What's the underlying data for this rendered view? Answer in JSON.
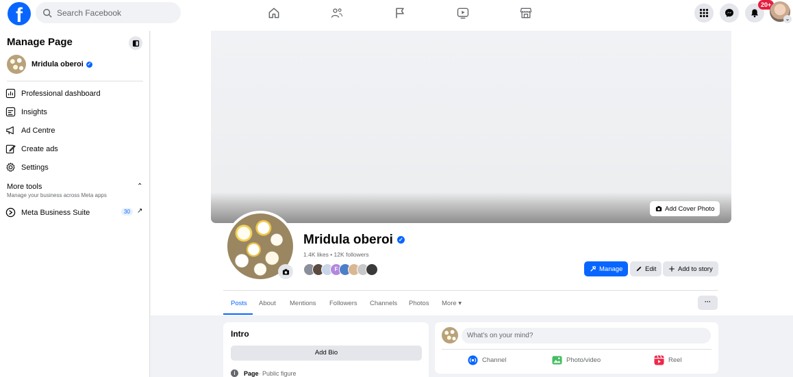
{
  "topbar": {
    "logo_letter": "f",
    "search_placeholder": "Search Facebook",
    "nav_icons": [
      "home-icon",
      "friends-icon",
      "flag-icon",
      "video-icon",
      "marketplace-icon"
    ],
    "right_icons": [
      "menu-grid-icon",
      "messenger-icon",
      "bell-icon"
    ],
    "notification_count": "20+"
  },
  "sidebar": {
    "title": "Manage Page",
    "page_name": "Mridula oberoi",
    "items": [
      {
        "label": "Professional dashboard",
        "icon": "dashboard-icon"
      },
      {
        "label": "Insights",
        "icon": "insights-icon"
      },
      {
        "label": "Ad Centre",
        "icon": "megaphone-icon"
      },
      {
        "label": "Create ads",
        "icon": "pencil-icon"
      },
      {
        "label": "Settings",
        "icon": "gear-icon"
      }
    ],
    "more_tools": {
      "title": "More tools",
      "subtitle": "Manage your business across Meta apps",
      "item_label": "Meta Business Suite",
      "item_badge": "30"
    }
  },
  "cover": {
    "add_cover_label": "Add Cover Photo"
  },
  "profile": {
    "name": "Mridula oberoi",
    "stats": "1.4K likes • 12K followers",
    "follower_avatar_colors": [
      "#8a8f99",
      "#5a4a40",
      "#c9d6e8",
      "#b388dd",
      "#4d7fc9",
      "#d9b891",
      "#c8c8c8",
      "#3a3a3a"
    ],
    "follower_avatar_letter": "F",
    "manage_label": "Manage",
    "edit_label": "Edit",
    "story_label": "Add to story"
  },
  "tabs": [
    {
      "label": "Posts",
      "active": true
    },
    {
      "label": "About",
      "active": false
    },
    {
      "label": "Mentions",
      "active": false
    },
    {
      "label": "Followers",
      "active": false
    },
    {
      "label": "Channels",
      "active": false
    },
    {
      "label": "Photos",
      "active": false
    },
    {
      "label": "More ▾",
      "active": false
    }
  ],
  "more_button_label": "···",
  "intro": {
    "title": "Intro",
    "add_bio_label": "Add Bio",
    "page_type_bold": "Page",
    "page_type_rest": " · Public figure"
  },
  "composer": {
    "placeholder": "What's on your mind?",
    "actions": [
      {
        "label": "Channel",
        "icon": "channel-icon",
        "color": "#0866ff"
      },
      {
        "label": "Photo/video",
        "icon": "photo-icon",
        "color": "#45bd62"
      },
      {
        "label": "Reel",
        "icon": "reel-icon",
        "color": "#f02849"
      }
    ]
  },
  "colors": {
    "accent": "#0866ff",
    "background": "#f0f2f5",
    "badge": "#e41e3f"
  }
}
